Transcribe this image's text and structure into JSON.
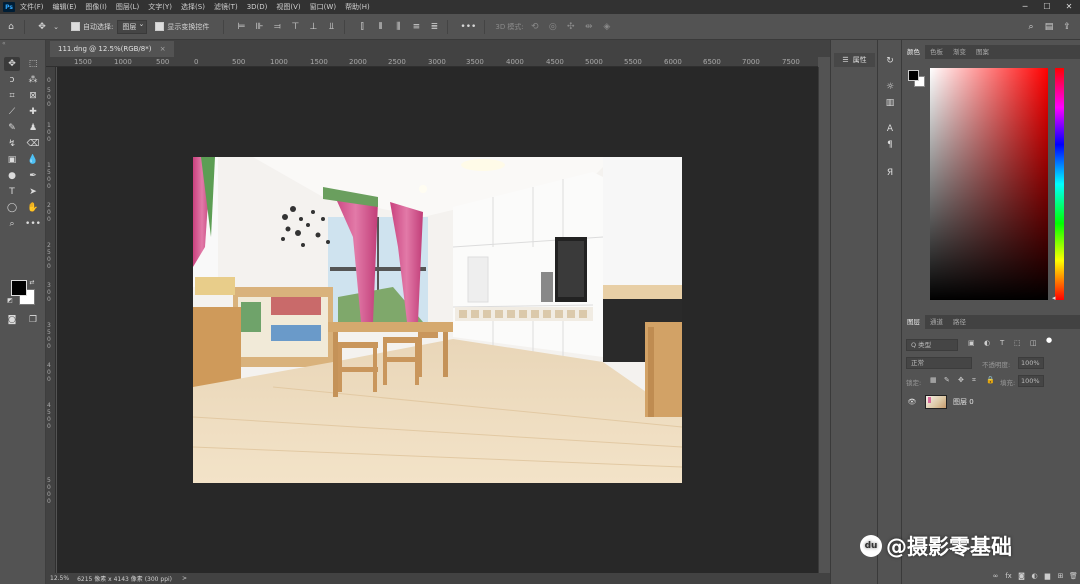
{
  "app": {
    "logo": "Ps",
    "brand_color": "#31a8ff"
  },
  "menu": [
    "文件(F)",
    "编辑(E)",
    "图像(I)",
    "图层(L)",
    "文字(Y)",
    "选择(S)",
    "滤镜(T)",
    "3D(D)",
    "视图(V)",
    "窗口(W)",
    "帮助(H)"
  ],
  "window_controls": [
    "─",
    "☐",
    "✕"
  ],
  "options": {
    "auto_select_label": "自动选择:",
    "auto_select_value": "图层",
    "show_transform_label": "显示变换控件",
    "more": "•••",
    "mode_3d": "3D 模式:"
  },
  "document": {
    "tab_label": "111.dng @ 12.5%(RGB/8*)",
    "close": "×"
  },
  "ruler_top": [
    "1500",
    "1000",
    "500",
    "0",
    "500",
    "1000",
    "1500",
    "2000",
    "2500",
    "3000",
    "3500",
    "4000",
    "4500",
    "5000",
    "5500",
    "6000",
    "6500",
    "7000",
    "7500"
  ],
  "ruler_left": [
    "0",
    "5",
    "0",
    "0",
    "1",
    "0",
    "0",
    "1",
    "5",
    "0",
    "0",
    "2",
    "0",
    "0",
    "2",
    "5",
    "0",
    "0",
    "3",
    "0",
    "0",
    "3",
    "5",
    "0",
    "0",
    "4",
    "0",
    "0",
    "4",
    "5",
    "0",
    "0",
    "5",
    "0",
    "0",
    "0"
  ],
  "status": {
    "zoom": "12.5%",
    "info": "6215 像素 x 4143 像素 (300 ppi)",
    "arrow": ">"
  },
  "properties_panel": {
    "title": "属性"
  },
  "color_panel": {
    "tabs": [
      "颜色",
      "色板",
      "渐变",
      "图案"
    ]
  },
  "layers_panel": {
    "tabs": [
      "图层",
      "通道",
      "路径"
    ],
    "filter_label": "Q 类型",
    "blend_mode": "正常",
    "opacity_label": "不透明度:",
    "opacity_value": "100%",
    "lock_label": "锁定:",
    "fill_label": "填充:",
    "fill_value": "100%",
    "layer_name": "图层 0"
  },
  "watermark": {
    "logo": "du",
    "text": "@摄影零基础"
  }
}
